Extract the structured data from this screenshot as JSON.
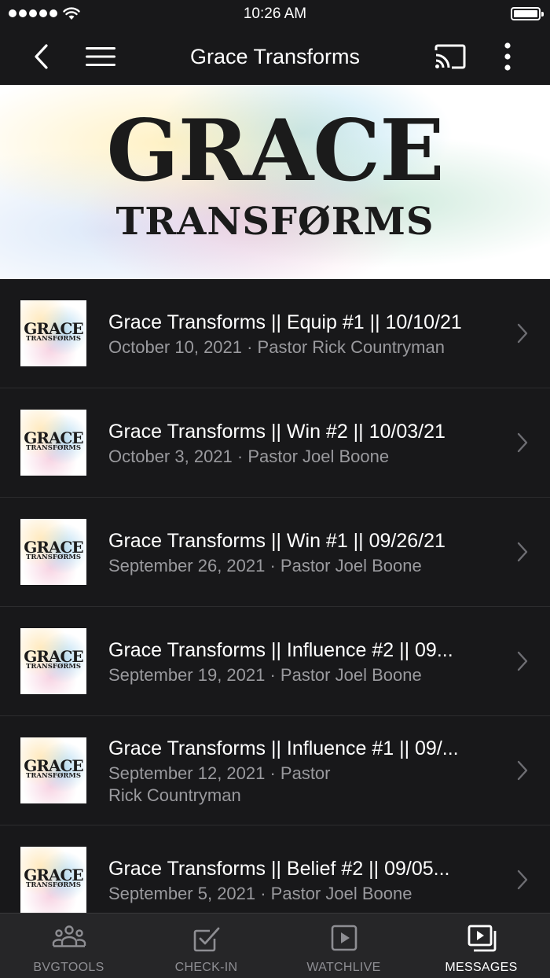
{
  "status_bar": {
    "time": "10:26 AM"
  },
  "nav": {
    "title": "Grace Transforms"
  },
  "banner": {
    "line1": "GRACE",
    "line2": "TRANSFØRMS"
  },
  "thumbnail": {
    "line1": "GRACE",
    "line2": "TRANSFØRMS"
  },
  "messages": [
    {
      "title": "Grace Transforms || Equip #1 || 10/10/21",
      "subtitle": "October 10, 2021 · Pastor Rick Countryman"
    },
    {
      "title": "Grace Transforms || Win #2 || 10/03/21",
      "subtitle": "October 3, 2021 · Pastor Joel Boone"
    },
    {
      "title": "Grace Transforms || Win #1 || 09/26/21",
      "subtitle": "September 26, 2021 · Pastor Joel Boone"
    },
    {
      "title": "Grace Transforms || Influence #2 || 09...",
      "subtitle": "September 19, 2021 · Pastor Joel Boone"
    },
    {
      "title": "Grace Transforms || Influence #1 || 09/...",
      "subtitle": "September 12, 2021 · Pastor Rick Countryman"
    },
    {
      "title": "Grace Transforms || Belief #2 || 09/05...",
      "subtitle": "September 5, 2021 · Pastor Joel Boone"
    }
  ],
  "tabs": [
    {
      "label": "BVGTOOLS",
      "icon": "people-icon",
      "active": false
    },
    {
      "label": "CHECK-IN",
      "icon": "checkbox-icon",
      "active": false
    },
    {
      "label": "WATCHLIVE",
      "icon": "play-icon",
      "active": false
    },
    {
      "label": "MESSAGES",
      "icon": "media-stack-icon",
      "active": true
    }
  ],
  "colors": {
    "background": "#18181a",
    "tab_bar": "#262628",
    "subtitle": "#9a9a9e",
    "inactive_tab": "#8e8e93"
  }
}
